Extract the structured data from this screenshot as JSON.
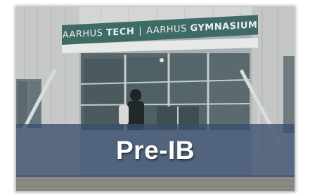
{
  "card": {
    "sign": {
      "left_word": "AARHUS",
      "left_bold": "TECH",
      "separator": "|",
      "right_word": "AARHUS",
      "right_bold": "GYMNASIUM"
    },
    "banner_title": "Pre-IB",
    "colors": {
      "banner": "#3a4e6e",
      "sign": "#3f6b66",
      "text": "#ffffff"
    }
  }
}
